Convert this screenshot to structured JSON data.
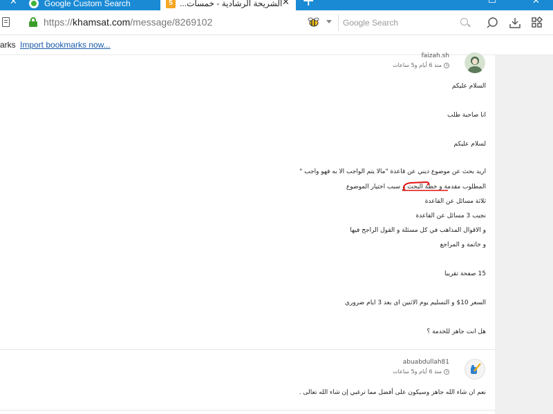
{
  "tabs": [
    {
      "label": "Google Custom Search",
      "icon": "google-icon",
      "active": false
    },
    {
      "label": "...الشريحة الرشادية - خمسات",
      "icon": "khamsat-icon",
      "active": true
    }
  ],
  "address_bar": {
    "protocol": "https://",
    "domain": "khamsat.com",
    "path": "/message/8269102"
  },
  "search": {
    "placeholder": "Google Search"
  },
  "bookmarks": {
    "label": "arks",
    "import_link": "Import bookmarks now..."
  },
  "messages": [
    {
      "author": "faizah.sh",
      "meta": "منذ 6 أيام و5 ساعات",
      "lines": [
        "السلام عليكم",
        "انا صاحبة طلب",
        "لسلام عليكم",
        "اريد بحث عن موضوع ديني عن قاعدة \"مالا يتم الواجب الا به فهو واجب \"",
        "المطلوب مقدمة و خطة البحث و سبب اختيار الموضوع",
        "ثلاثة مسائل عن القاعدة",
        "نجيب 3 مسائل عن القاعدة",
        "و الاقوال المذاهب في كل مسئلة و القول الراجح فيها",
        "و خاتمة و المراجع",
        "15 صفحة تقريبا",
        "السعر 10$ و التسليم يوم الاثنين اي بعد 3 ايام ضروري",
        "هل انت جاهز للخدمة ؟"
      ]
    },
    {
      "author": "abuabdullah81",
      "meta": "منذ 6 أيام و5 ساعات",
      "lines": [
        "نعم ان شاء الله جاهز وسيكون على أفضل مما ترغبي إن شاء الله تعالى ."
      ]
    }
  ],
  "colors": {
    "tab_strip": "#1a8ad4",
    "lock_green": "#3a9d2a",
    "link_blue": "#1a5aa8",
    "annotation_red": "#e01010"
  }
}
